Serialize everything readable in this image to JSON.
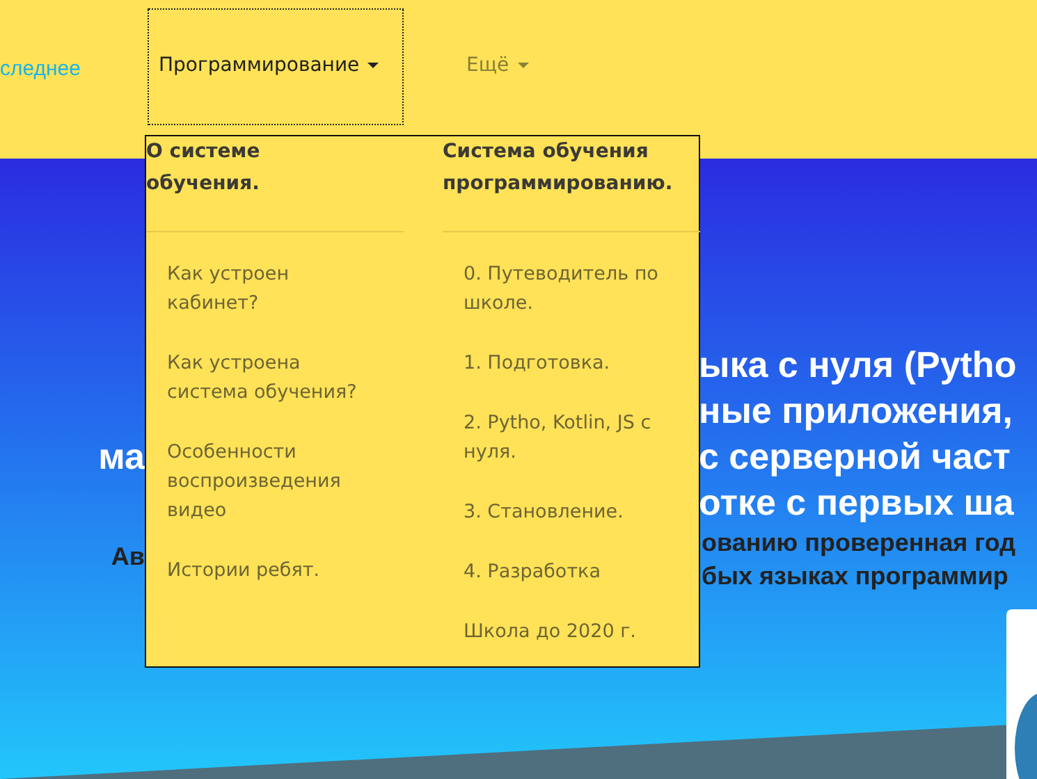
{
  "nav": {
    "items": [
      {
        "label": "следнее",
        "kind": "link"
      },
      {
        "label": "Программирование",
        "kind": "dropdown",
        "expanded": true
      },
      {
        "label": "Ещё",
        "kind": "dropdown",
        "expanded": false
      }
    ]
  },
  "dropdown": {
    "columns": [
      {
        "heading": "О системе обучения.",
        "items": [
          "Как устроен кабинет?",
          "Как устроена система обучения?",
          "Особенности воспроизведения видео",
          "Истории ребят."
        ]
      },
      {
        "heading": "Система обучения программированию.",
        "items": [
          "0. Путеводитель по школе.",
          "1. Подготовка.",
          "2. Pytho, Kotlin, JS с нуля.",
          "3. Становление.",
          "4. Разработка",
          "Школа до 2020 г."
        ]
      }
    ]
  },
  "hero": {
    "title_left": [
      "ма"
    ],
    "title_right": [
      "ыка с нуля (Pytho",
      "ные приложения,",
      "с серверной част",
      "отке с первых ша"
    ],
    "subtitle_left": [
      "Ав"
    ],
    "subtitle_right": [
      "ованию проверенная год",
      "бых языках программир"
    ]
  }
}
